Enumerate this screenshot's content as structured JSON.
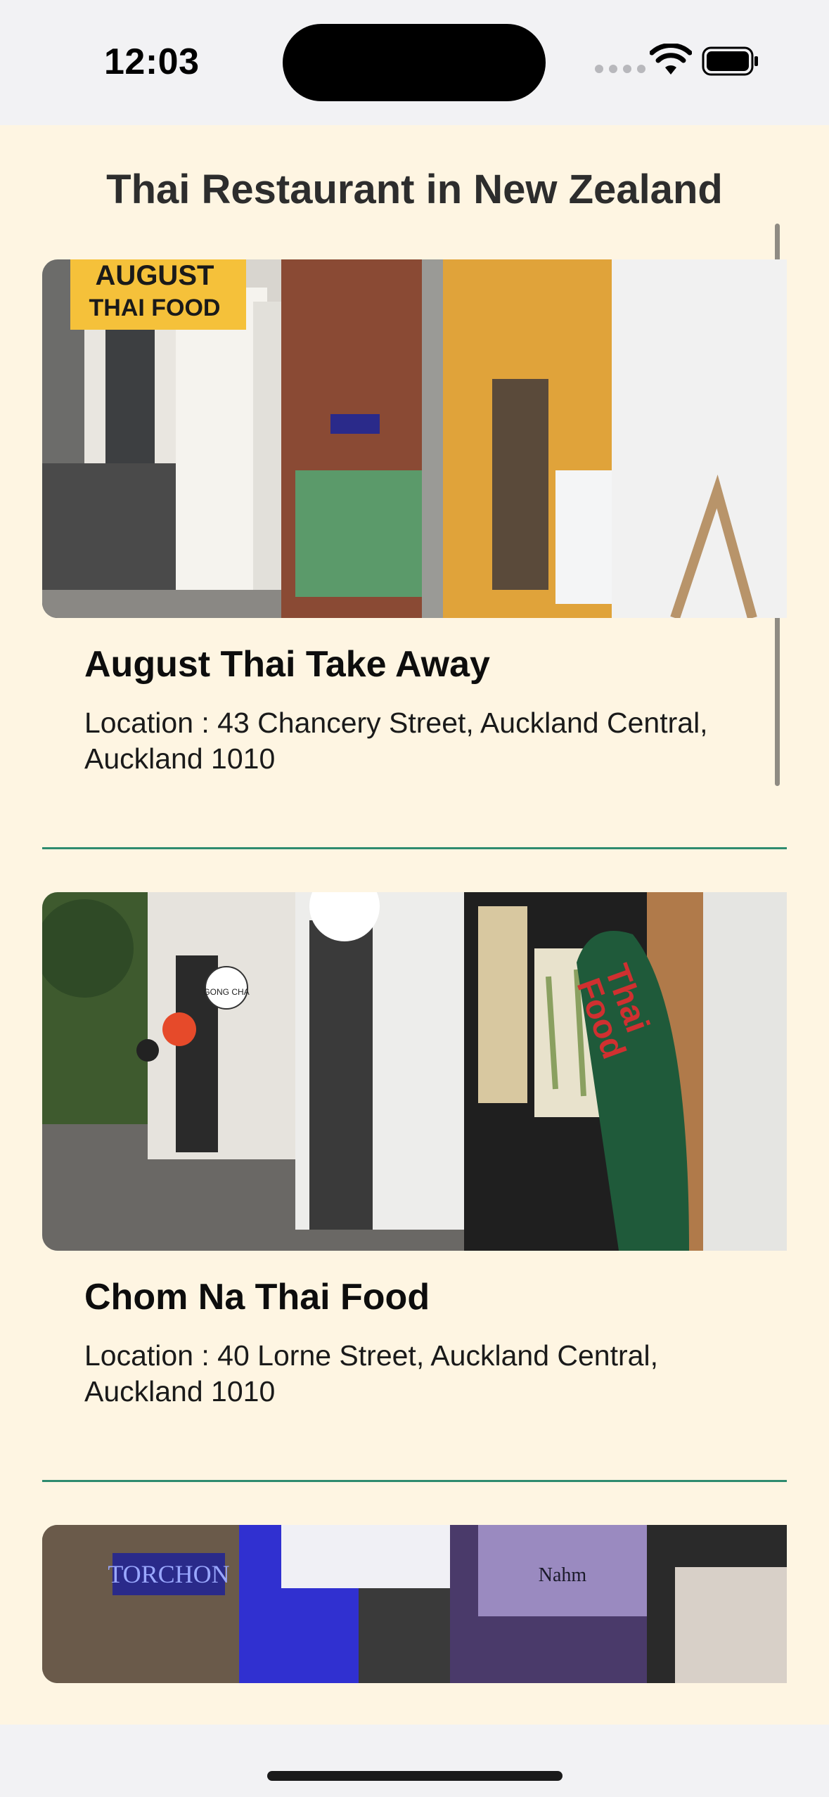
{
  "status_bar": {
    "time": "12:03"
  },
  "page": {
    "title": "Thai Restaurant in New Zealand"
  },
  "restaurants": [
    {
      "name": "August Thai Take Away",
      "location": "Location : 43 Chancery Street, Auckland Central, Auckland 1010",
      "sign_text": "AUGUST THAI FOOD"
    },
    {
      "name": "Chom Na Thai Food",
      "location": "Location : 40 Lorne Street, Auckland Central, Auckland 1010",
      "sign_text": "Thai Food",
      "store_sign": "GONG CHA"
    },
    {
      "sign_text": "TORCHON",
      "extra_sign": "Nahm"
    }
  ],
  "colors": {
    "background": "#fef5e2",
    "divider": "#2e8b6f",
    "title": "#2d2d2d"
  }
}
